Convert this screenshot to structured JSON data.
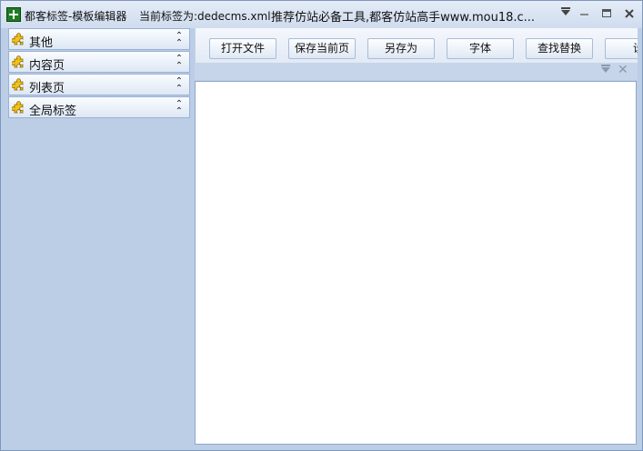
{
  "window": {
    "title": "都客标签-模板编辑器",
    "current_tag": "当前标签为:dedecms.xml",
    "recommend": "推荐仿站必备工具,都客仿站高手www.mou18.c..."
  },
  "sidebar": {
    "items": [
      {
        "label": "其他",
        "icon": "puzzle-icon",
        "chevron": "double-chevron-up-icon"
      },
      {
        "label": "内容页",
        "icon": "puzzle-icon",
        "chevron": "double-chevron-up-icon"
      },
      {
        "label": "列表页",
        "icon": "puzzle-icon",
        "chevron": "double-chevron-up-icon"
      },
      {
        "label": "全局标签",
        "icon": "puzzle-icon",
        "chevron": "double-chevron-up-icon"
      }
    ]
  },
  "toolbar": {
    "open_file": "打开文件",
    "save_current": "保存当前页",
    "save_as": "另存为",
    "font": "字体",
    "find_replace": "查找替换",
    "settings": "设"
  },
  "editor": {
    "content": ""
  },
  "colors": {
    "accent": "#bccde6",
    "border": "#98b1d4",
    "icon_yellow": "#f2c21a"
  }
}
